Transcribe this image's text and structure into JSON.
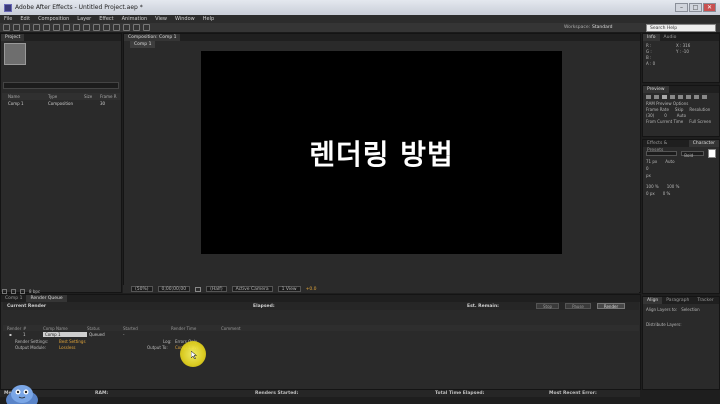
{
  "window": {
    "title": "Adobe After Effects - Untitled Project.aep *"
  },
  "menu": [
    "File",
    "Edit",
    "Composition",
    "Layer",
    "Effect",
    "Animation",
    "View",
    "Window",
    "Help"
  ],
  "workspace": {
    "label": "Workspace:",
    "value": "Standard"
  },
  "search_help": {
    "placeholder": "Search Help"
  },
  "project": {
    "tab": "Project",
    "columns": [
      "Name",
      "Type",
      "Size",
      "Frame R"
    ],
    "items": [
      {
        "name": "Comp 1",
        "type": "Composition",
        "size": "",
        "frame_rate": "30"
      }
    ],
    "footer_bpc": "8 bpc"
  },
  "composition": {
    "tab": "Composition: Comp 1",
    "sub_tab": "Comp 1",
    "canvas_text": "렌더링 방법",
    "controls": {
      "zoom": "(50%)",
      "timecode": "0;00;00;00",
      "resolution": "(Half)",
      "camera": "Active Camera",
      "view": "1 View",
      "exposure": "+0.0"
    }
  },
  "info": {
    "tabs": [
      "Info",
      "Audio"
    ],
    "r": "R :",
    "g": "G :",
    "b": "B :",
    "a": "A : 0",
    "x": "X : 316",
    "y": "Y : -10"
  },
  "preview": {
    "tab": "Preview",
    "ram_label": "RAM Preview Options",
    "frame_rate_label": "Frame Rate",
    "skip_label": "Skip",
    "resolution_label": "Resolution",
    "frame_rate": "(30)",
    "skip": "0",
    "resolution": "Auto",
    "from_current": "From Current Time",
    "full_screen": "Full Screen"
  },
  "character": {
    "tabs": [
      "Effects & Presets",
      "Character"
    ],
    "font": "Bold",
    "size": "71 px",
    "leading": "Auto",
    "tracking": "0",
    "stroke": "px",
    "vscale": "100 %",
    "hscale": "100 %",
    "baseline": "0 px",
    "tsume": "0 %"
  },
  "align": {
    "tabs": [
      "Align",
      "Paragraph",
      "Tracker"
    ],
    "align_to_label": "Align Layers to:",
    "align_to_value": "Selection",
    "distribute_label": "Distribute Layers:"
  },
  "timeline_tabs": [
    "Comp 1",
    "Render Queue"
  ],
  "render_queue": {
    "current_render": "Current Render",
    "elapsed_label": "Elapsed:",
    "remain_label": "Est. Remain:",
    "buttons": {
      "stop": "Stop",
      "pause": "Pause",
      "render": "Render"
    },
    "columns": [
      "Render",
      "#",
      "Comp Name",
      "Status",
      "Started",
      "Render Time",
      "Comment"
    ],
    "items": [
      {
        "num": "1",
        "comp": "Comp 1",
        "status": "Queued",
        "started": "-",
        "render_time": ""
      }
    ],
    "render_settings_label": "Render Settings:",
    "render_settings_value": "Best Settings",
    "log_label": "Log:",
    "log_value": "Errors Only",
    "output_module_label": "Output Module:",
    "output_module_value": "Lossless",
    "output_to_label": "Output To:",
    "output_to_value": "Comp 1.avi"
  },
  "status_bar": {
    "message": "Message:",
    "ram": "RAM:",
    "renders_started": "Renders Started:",
    "total_time": "Total Time Elapsed:",
    "recent_error": "Most Recent Error:"
  }
}
